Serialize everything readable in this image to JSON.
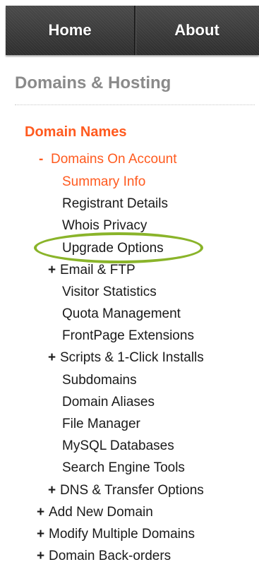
{
  "nav": {
    "home_label": "Home",
    "about_label": "About"
  },
  "section": {
    "title": "Domains & Hosting"
  },
  "tree": {
    "domain_names": "Domain Names",
    "domains_on_account": "Domains On Account",
    "collapse_symbol": "-",
    "expand_symbol": "+",
    "summary_info": "Summary Info",
    "registrant_details": "Registrant Details",
    "whois_privacy": "Whois Privacy",
    "upgrade_options": "Upgrade Options",
    "email_ftp": "Email & FTP",
    "visitor_statistics": "Visitor Statistics",
    "quota_management": "Quota Management",
    "frontpage_extensions": "FrontPage Extensions",
    "scripts_installs": "Scripts & 1-Click Installs",
    "subdomains": "Subdomains",
    "domain_aliases": "Domain Aliases",
    "file_manager": "File Manager",
    "mysql_databases": "MySQL Databases",
    "search_engine_tools": "Search Engine Tools",
    "dns_transfer_options": "DNS & Transfer Options",
    "add_new_domain": "Add New Domain",
    "modify_multiple_domains": "Modify Multiple Domains",
    "domain_back_orders": "Domain Back-orders"
  },
  "colors": {
    "accent_orange": "#ff5a1f",
    "highlight_green": "#8ab42a",
    "nav_dark": "#3c3c3c",
    "section_gray": "#8a8a8a"
  }
}
